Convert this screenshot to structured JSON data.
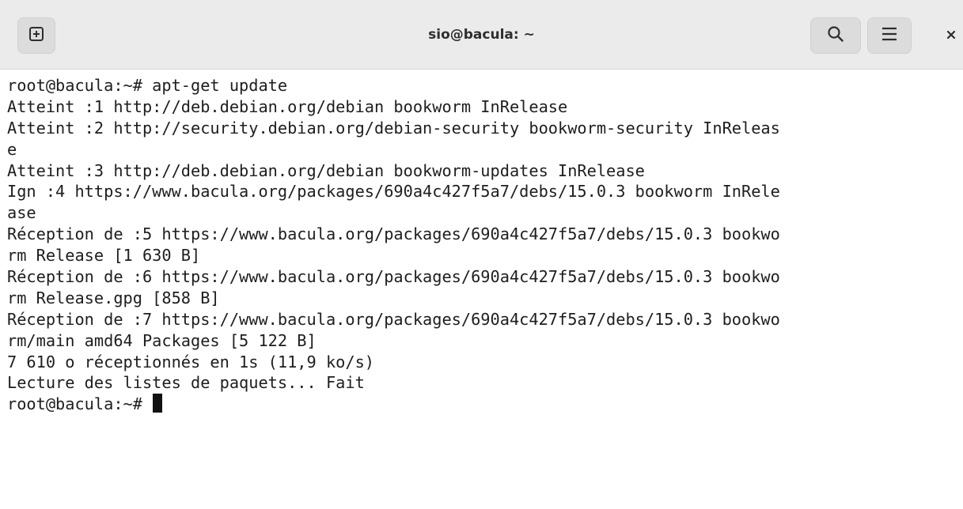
{
  "window": {
    "title": "sio@bacula: ~"
  },
  "titlebar": {
    "new_tab_icon": "new-tab-plus-icon",
    "search_icon": "search-icon",
    "menu_icon": "hamburger-menu-icon",
    "close_icon": "close-icon",
    "close_glyph": "×"
  },
  "colors": {
    "titlebar_bg": "#ebebeb",
    "terminal_bg": "#ffffff",
    "terminal_fg": "#1e1e1e"
  },
  "terminal": {
    "lines": [
      "root@bacula:~# apt-get update",
      "Atteint :1 http://deb.debian.org/debian bookworm InRelease",
      "Atteint :2 http://security.debian.org/debian-security bookworm-security InReleas",
      "e",
      "Atteint :3 http://deb.debian.org/debian bookworm-updates InRelease",
      "Ign :4 https://www.bacula.org/packages/690a4c427f5a7/debs/15.0.3 bookworm InRele",
      "ase",
      "Réception de :5 https://www.bacula.org/packages/690a4c427f5a7/debs/15.0.3 bookwo",
      "rm Release [1 630 B]",
      "Réception de :6 https://www.bacula.org/packages/690a4c427f5a7/debs/15.0.3 bookwo",
      "rm Release.gpg [858 B]",
      "Réception de :7 https://www.bacula.org/packages/690a4c427f5a7/debs/15.0.3 bookwo",
      "rm/main amd64 Packages [5 122 B]",
      "7 610 o réceptionnés en 1s (11,9 ko/s)",
      "Lecture des listes de paquets... Fait"
    ],
    "prompt": "root@bacula:~# "
  }
}
